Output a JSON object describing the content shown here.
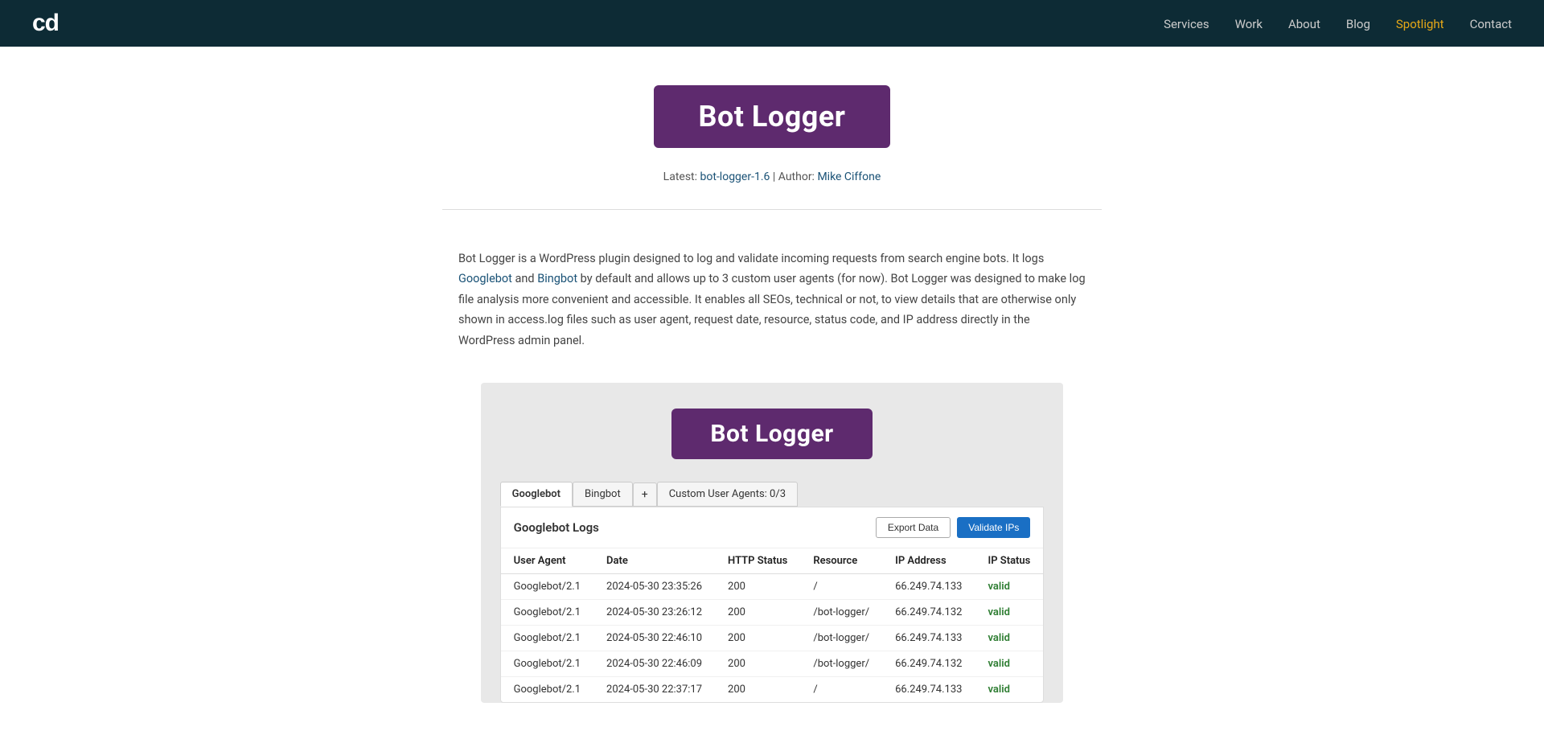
{
  "nav": {
    "logo": "cd",
    "links": [
      {
        "label": "Services",
        "id": "services",
        "active": false
      },
      {
        "label": "Work",
        "id": "work",
        "active": false
      },
      {
        "label": "About",
        "id": "about",
        "active": false
      },
      {
        "label": "Blog",
        "id": "blog",
        "active": false
      },
      {
        "label": "Spotlight",
        "id": "spotlight",
        "active": true
      },
      {
        "label": "Contact",
        "id": "contact",
        "active": false
      }
    ]
  },
  "hero": {
    "badge": "Bot Logger",
    "meta_latest": "Latest:",
    "meta_version": "bot-logger-1.6",
    "meta_separator": " | ",
    "meta_author_label": "Author:",
    "meta_author": "Mike Ciffone"
  },
  "description": {
    "text_before_googlebot": "Bot Logger is a WordPress plugin designed to log and validate incoming requests from search engine bots. It logs ",
    "googlebot_link": "Googlebot",
    "text_after_googlebot": " and ",
    "bingbot_link": "Bingbot",
    "text_rest": " by default and allows up to 3 custom user agents (for now). Bot Logger was designed to make log file analysis more convenient and accessible. It enables all SEOs, technical or not, to view details that are otherwise only shown in access.log files such as user agent, request date, resource, status code, and IP address directly in the WordPress admin panel."
  },
  "screenshot": {
    "badge": "Bot Logger",
    "tabs": [
      {
        "label": "Googlebot",
        "active": true
      },
      {
        "label": "Bingbot",
        "active": false
      },
      {
        "label": "+",
        "active": false,
        "is_plus": true
      },
      {
        "label": "Custom User Agents: 0/3",
        "active": false
      }
    ],
    "table_title": "Googlebot Logs",
    "export_label": "Export Data",
    "validate_label": "Validate IPs",
    "columns": [
      "User Agent",
      "Date",
      "HTTP Status",
      "Resource",
      "IP Address",
      "IP Status"
    ],
    "rows": [
      {
        "user_agent": "Googlebot/2.1",
        "date": "2024-05-30 23:35:26",
        "http_status": "200",
        "resource": "/",
        "ip_address": "66.249.74.133",
        "ip_status": "valid"
      },
      {
        "user_agent": "Googlebot/2.1",
        "date": "2024-05-30 23:26:12",
        "http_status": "200",
        "resource": "/bot-logger/",
        "ip_address": "66.249.74.132",
        "ip_status": "valid"
      },
      {
        "user_agent": "Googlebot/2.1",
        "date": "2024-05-30 22:46:10",
        "http_status": "200",
        "resource": "/bot-logger/",
        "ip_address": "66.249.74.133",
        "ip_status": "valid"
      },
      {
        "user_agent": "Googlebot/2.1",
        "date": "2024-05-30 22:46:09",
        "http_status": "200",
        "resource": "/bot-logger/",
        "ip_address": "66.249.74.132",
        "ip_status": "valid"
      },
      {
        "user_agent": "Googlebot/2.1",
        "date": "2024-05-30 22:37:17",
        "http_status": "200",
        "resource": "/",
        "ip_address": "66.249.74.133",
        "ip_status": "valid"
      }
    ]
  },
  "colors": {
    "nav_bg": "#0d2b35",
    "spotlight": "#e6a817",
    "badge_bg": "#5e2a6e",
    "validate_btn": "#1a6fc4",
    "valid_green": "#2e7d32"
  }
}
